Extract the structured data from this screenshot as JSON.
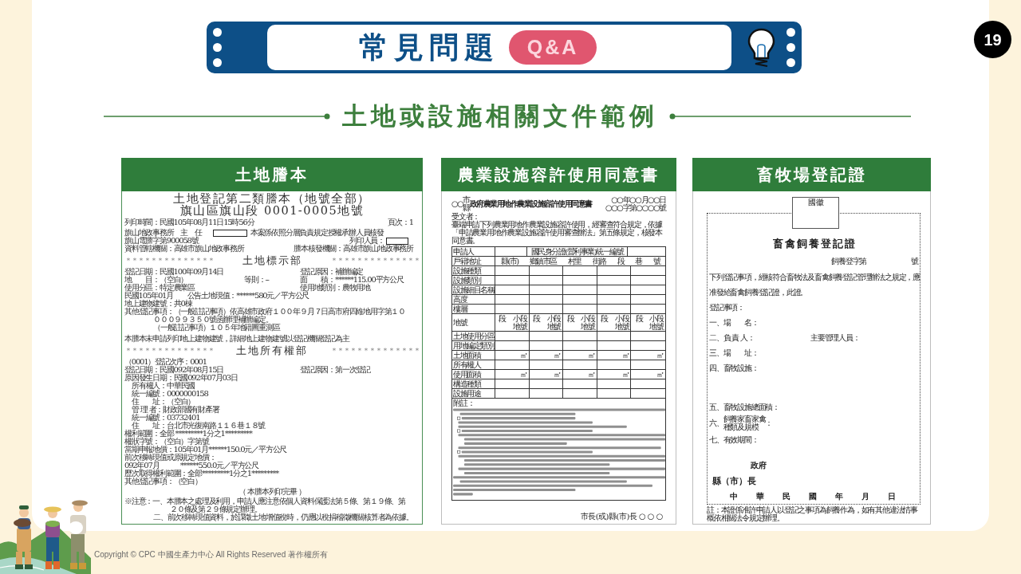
{
  "header": {
    "title": "常見問題",
    "badge": "Q&A"
  },
  "page_number": "19",
  "subtitle": "土地或設施相關文件範例",
  "panels": [
    {
      "kind": "land_transcript",
      "title": "土地謄本",
      "document": {
        "lines": [
          {
            "kind": "title",
            "parts": [
              "土地登記第二類謄本（地號全部）"
            ]
          },
          {
            "kind": "title",
            "parts": [
              "旗山區旗山段 0001-0005地號"
            ]
          },
          {
            "kind": "row",
            "parts": [
              "列印時間：民國105年08月11日15時56分",
              "頁次：1"
            ]
          },
          {
            "kind": "row_redact_mid",
            "parts": [
              "旗山地政事務所　主　任",
              "本案係依照分層負責規定授權承辦人員核發"
            ]
          },
          {
            "kind": "row_redact_end",
            "parts": [
              "旗山電謄字第900058號",
              "列印人員："
            ]
          },
          {
            "kind": "row",
            "parts": [
              "資料管轄機關：高雄市旗山地政事務所",
              "謄本核發機關：高雄市旗山地政事務所"
            ]
          },
          {
            "kind": "section",
            "parts": [
              "＊＊＊＊＊＊＊＊＊＊＊＊＊＊",
              "土地標示部",
              "＊＊＊＊＊＊＊＊＊＊＊＊＊＊"
            ]
          },
          {
            "kind": "fields",
            "parts": [
              "登記日期：民國100年09月14日",
              "登記原因：補辦編定"
            ]
          },
          {
            "kind": "fields",
            "parts": [
              "地　　目：（空白）",
              "等則：--",
              "面　　積：******115.00平方公尺"
            ]
          },
          {
            "kind": "fields",
            "parts": [
              "使用分區：特定農業區",
              "使用地類別：農牧用地"
            ]
          },
          {
            "kind": "line",
            "parts": [
              "民國105年01月　　公告土地現值：******580元／平方公尺"
            ]
          },
          {
            "kind": "line",
            "parts": [
              "地上建物建號：共0棟"
            ]
          },
          {
            "kind": "line",
            "parts": [
              "其他登記事項：（一般註記事項）依高雄市政府１００年９月７日高市府四維地用字第１０"
            ]
          },
          {
            "kind": "cont",
            "parts": [
              "０００９９３５０號函辦理補辦編定。"
            ]
          },
          {
            "kind": "cont",
            "parts": [
              "（一般註記事項）１０５年地籍圖重測區"
            ]
          },
          {
            "kind": "remark",
            "parts": [
              "本謄本未申請列印地上建物建號，詳細地上建物建號以登記機關登記為主"
            ]
          },
          {
            "kind": "section",
            "parts": [
              "＊＊＊＊＊＊＊＊＊＊＊＊＊＊",
              "土地所有權部",
              "＊＊＊＊＊＊＊＊＊＊＊＊＊＊"
            ]
          },
          {
            "kind": "line",
            "parts": [
              "（0001）登記次序：0001"
            ]
          },
          {
            "kind": "fields",
            "parts": [
              "登記日期：民國092年08月15日",
              "登記原因：第一次登記"
            ]
          },
          {
            "kind": "line",
            "parts": [
              "原因發生日期：民國092年07月03日"
            ]
          },
          {
            "kind": "sub",
            "parts": [
              "所有權人：中華民國"
            ]
          },
          {
            "kind": "sub",
            "parts": [
              "統一編號：0000000158"
            ]
          },
          {
            "kind": "sub",
            "parts": [
              "住　　址：（空白）"
            ]
          },
          {
            "kind": "sub",
            "parts": [
              "管 理 者：財政部國有財產署"
            ]
          },
          {
            "kind": "sub",
            "parts": [
              "統一編號：03732401"
            ]
          },
          {
            "kind": "sub",
            "parts": [
              "住　　址：台北市光復南路１１６巷１８號"
            ]
          },
          {
            "kind": "line",
            "parts": [
              "權利範圍：全部 *********1分之1*********"
            ]
          },
          {
            "kind": "line",
            "parts": [
              "權狀字號：（空白）字第號"
            ]
          },
          {
            "kind": "line",
            "parts": [
              "當期申報地價：105年01月******150.0元／平方公尺"
            ]
          },
          {
            "kind": "line",
            "parts": [
              "前次移轉現值或原規定地價："
            ]
          },
          {
            "kind": "line",
            "parts": [
              "092年07月　　　******550.0元／平方公尺"
            ]
          },
          {
            "kind": "line",
            "parts": [
              "歷次取得權利範圍：全部*********1分之1*********"
            ]
          },
          {
            "kind": "line",
            "parts": [
              "其他登記事項：（空白）"
            ]
          },
          {
            "kind": "center",
            "parts": [
              "（ 本謄本列印完畢 ）"
            ]
          },
          {
            "kind": "note",
            "parts": [
              "※注意：一、本謄本之處理及利用，申請人應注意依個人資料保護法第５條、第１９條、第"
            ]
          },
          {
            "kind": "note_cont",
            "parts": [
              "２０條及第２９條規定辦理。"
            ]
          },
          {
            "kind": "note_sub",
            "parts": [
              "二、前次移轉現值資料，於課徵土地增值稅時，仍應以稅捐稽徵機關核算者為依據。"
            ]
          }
        ]
      }
    },
    {
      "kind": "permit",
      "title": "農業設施容許使用同意書",
      "document": {
        "title": {
          "prefix": "○○",
          "stack": [
            "市",
            "縣"
          ],
          "text": "政府農業用地作農業設施容許使用同意書"
        },
        "meta": [
          "○○年○○月○○日",
          "○○○字第○○○○號"
        ],
        "recipient": "受文者：",
        "intro": "臺端申請下列農業用地作農業設施容許使用，經審查符合規定，依據「申請農業用地作農業設施容許使用審查辦法」第五條規定，核發本同意書。",
        "applicant_row": [
          "申請人",
          "國民身分證(營利事業)統一編號"
        ],
        "address_row": [
          "戶籍地址",
          "縣(市)",
          "鄉鎮市區",
          "村里",
          "街路",
          "段",
          "巷",
          "號"
        ],
        "rows": [
          {
            "label": "設施種類"
          },
          {
            "label": "設施類別"
          },
          {
            "label": "設施細目名稱"
          },
          {
            "label": "高度"
          },
          {
            "label": "樓層"
          },
          {
            "label": "地號",
            "cells": [
              [
                "段　小段",
                "地號"
              ],
              [
                "段　小段",
                "地號"
              ],
              [
                "段　小段",
                "地號"
              ],
              [
                "段　小段",
                "地號"
              ],
              [
                "段　小段",
                "地號"
              ]
            ]
          },
          {
            "label": "土地使用分區"
          },
          {
            "label": "用地編定類別"
          },
          {
            "label": "土地面積",
            "cells": [
              [
                "㎡"
              ],
              [
                "㎡"
              ],
              [
                "㎡"
              ],
              [
                "㎡"
              ],
              [
                "㎡"
              ]
            ]
          },
          {
            "label": "所有權人"
          },
          {
            "label": "使用面積",
            "cells": [
              [
                "㎡"
              ],
              [
                "㎡"
              ],
              [
                "㎡"
              ],
              [
                "㎡"
              ],
              [
                "㎡"
              ]
            ]
          },
          {
            "label": "構造種類"
          },
          {
            "label": "設施用途"
          }
        ],
        "notes_title": "附註：",
        "signature": "市長(或)縣(市)長 ○ ○ ○"
      }
    },
    {
      "kind": "certificate",
      "title": "畜牧場登記證",
      "document": {
        "emblem": "國徽",
        "title": "畜禽飼養登記證",
        "number": [
          "飼養登字第",
          "號"
        ],
        "text": "下列登記事項，經核符合畜牧法及畜禽飼養登記管理辦法之規定，應准發給畜禽飼養登記證，此證。",
        "entries": [
          {
            "kind": "line",
            "parts": [
              "登記事項："
            ]
          },
          {
            "kind": "line",
            "parts": [
              "一、場　　名："
            ]
          },
          {
            "kind": "line",
            "parts": [
              "二、負 責 人：",
              "主要管理人員："
            ]
          },
          {
            "kind": "line",
            "parts": [
              "三、場　　址："
            ]
          },
          {
            "kind": "tall",
            "parts": [
              "四、畜牧設施："
            ]
          },
          {
            "kind": "line",
            "parts": [
              "五、畜牧設施總面積："
            ]
          },
          {
            "kind": "stacked",
            "parts": [
              "六、",
              "飼養家畜家禽",
              "種類及規模",
              "："
            ]
          },
          {
            "kind": "line",
            "parts": [
              "七、有效期間："
            ]
          }
        ],
        "issuer": "政府",
        "head": "縣（市）長",
        "date": [
          "中",
          "華",
          "民",
          "國",
          "年",
          "月",
          "日"
        ],
        "footnote": "註：本證係准許申請人以登記之事項為飼養作為，如有其他違法情事概依相關法令規定辦理。"
      }
    }
  ],
  "copyright": "Copyright © CPC 中國生產力中心 All Rights Reserved 著作權所有"
}
